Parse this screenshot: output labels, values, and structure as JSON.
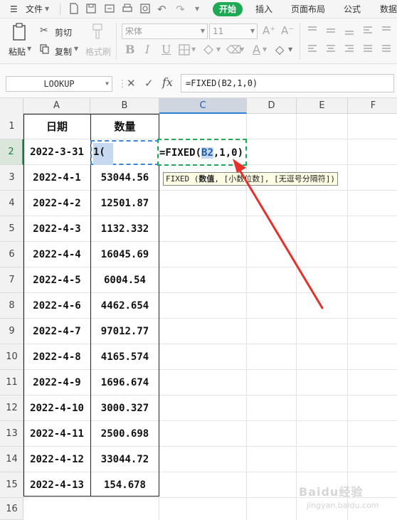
{
  "menubar": {
    "file_label": "文件",
    "tabs": [
      "开始",
      "插入",
      "页面布局",
      "公式",
      "数据"
    ]
  },
  "ribbon": {
    "cut_label": "剪切",
    "paste_label": "粘贴",
    "copy_label": "复制",
    "format_painter_label": "格式刷",
    "font_name": "宋体",
    "font_size": "11",
    "bold": "B",
    "italic": "I",
    "underline": "U"
  },
  "formula_bar": {
    "name_box": "LOOKUP",
    "fx_label": "fx",
    "formula": "=FIXED(B2,1,0)"
  },
  "sheet": {
    "columns": [
      "A",
      "B",
      "C",
      "D",
      "E",
      "F"
    ],
    "row_numbers": [
      "1",
      "2",
      "3",
      "4",
      "5",
      "6",
      "7",
      "8",
      "9",
      "10",
      "11",
      "12",
      "13",
      "14",
      "15",
      "16"
    ],
    "header_date": "日期",
    "header_qty": "数量",
    "rows": [
      {
        "date": "2022-3-31",
        "qty": "1("
      },
      {
        "date": "2022-4-1",
        "qty": "53044.56"
      },
      {
        "date": "2022-4-2",
        "qty": "12501.87"
      },
      {
        "date": "2022-4-3",
        "qty": "1132.332"
      },
      {
        "date": "2022-4-4",
        "qty": "16045.69"
      },
      {
        "date": "2022-4-5",
        "qty": "6004.54"
      },
      {
        "date": "2022-4-6",
        "qty": "4462.654"
      },
      {
        "date": "2022-4-7",
        "qty": "97012.77"
      },
      {
        "date": "2022-4-8",
        "qty": "4165.574"
      },
      {
        "date": "2022-4-9",
        "qty": "1696.674"
      },
      {
        "date": "2022-4-10",
        "qty": "3000.327"
      },
      {
        "date": "2022-4-11",
        "qty": "2500.698"
      },
      {
        "date": "2022-4-12",
        "qty": "33044.72"
      },
      {
        "date": "2022-4-13",
        "qty": "154.678"
      }
    ],
    "edit_cell": {
      "prefix": "=FIXED(",
      "ref": "B2",
      "suffix": ",1,0)"
    },
    "tooltip": {
      "fn": "FIXED",
      "open": " (",
      "arg1": "数值",
      "rest": ", [小数位数], [无逗号分隔符])"
    }
  },
  "watermark": {
    "text": "Baidu经验",
    "sub": "jingyan.baidu.com"
  },
  "colors": {
    "accent": "#1ea955",
    "ref_blue": "#3d87d6",
    "arrow_red": "#e8302a"
  }
}
